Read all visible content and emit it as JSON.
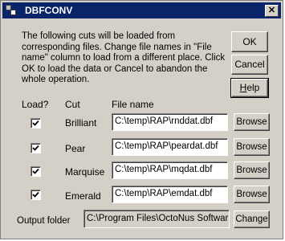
{
  "window": {
    "title": "DBFCONV",
    "close_glyph": "✕"
  },
  "description": "The following cuts will be loaded from corresponding files. Change file names in \"File name\" column to load from a different place. Click OK to load the data or Cancel to abandon the whole operation.",
  "buttons": {
    "ok": "OK",
    "cancel": "Cancel",
    "help_key": "H",
    "help_rest": "elp",
    "browse": "Browse",
    "change": "Change"
  },
  "columns": {
    "load": "Load?",
    "cut": "Cut",
    "file": "File name"
  },
  "rows": [
    {
      "checked": true,
      "cut": "Brilliant",
      "file": "C:\\temp\\RAP\\rnddat.dbf"
    },
    {
      "checked": true,
      "cut": "Pear",
      "file": "C:\\temp\\RAP\\peardat.dbf"
    },
    {
      "checked": true,
      "cut": "Marquise",
      "file": "C:\\temp\\RAP\\mqdat.dbf"
    },
    {
      "checked": true,
      "cut": "Emerald",
      "file": "C:\\temp\\RAP\\emdat.dbf"
    }
  ],
  "output": {
    "label": "Output folder",
    "value": "C:\\Program Files\\OctoNus Softwar"
  }
}
